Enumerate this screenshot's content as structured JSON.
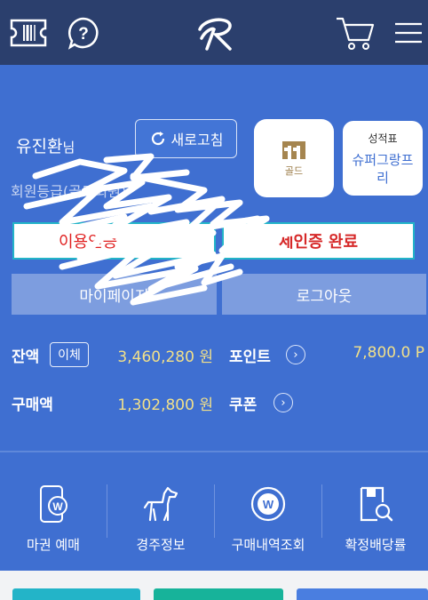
{
  "header": {
    "ticket_icon": "ticket-icon",
    "help_icon": "help-icon",
    "logo_icon": "brand-logo-icon",
    "cart_icon": "cart-icon",
    "menu_icon": "hamburger-menu-icon"
  },
  "user": {
    "name": "유진환",
    "suffix": "님",
    "grade_partial": "회원등급(골드회원)"
  },
  "refresh": {
    "label": "새로고침"
  },
  "grade_card": {
    "label": "골드"
  },
  "report_card": {
    "title": "성적표",
    "value": "슈퍼그랑프리"
  },
  "auth": {
    "left": "이용인증",
    "right": "세인증 완료"
  },
  "buttons": {
    "mypage": "마이페이지",
    "logout": "로그아웃"
  },
  "balance": {
    "label": "잔액",
    "transfer": "이체",
    "value": "3,460,280 원",
    "purchase_label": "구매액",
    "purchase_value": "1,302,800 원"
  },
  "point": {
    "label": "포인트",
    "value": "7,800.0 P"
  },
  "coupon": {
    "label": "쿠폰"
  },
  "quick_menu": [
    {
      "label": "마권 예매",
      "icon": "mobile-ticket-icon"
    },
    {
      "label": "경주정보",
      "icon": "horse-icon"
    },
    {
      "label": "구매내역조회",
      "icon": "won-coin-icon"
    },
    {
      "label": "확정배당률",
      "icon": "document-search-icon"
    }
  ],
  "colors": {
    "header_bg": "#2b3f6d",
    "panel_bg": "#3f6fd1",
    "accent_yellow": "#f1e08a",
    "auth_red": "#d62828",
    "tab_cyan": "#23b4c8",
    "tab_teal": "#17b39a",
    "tab_blue": "#4a7ee0"
  }
}
